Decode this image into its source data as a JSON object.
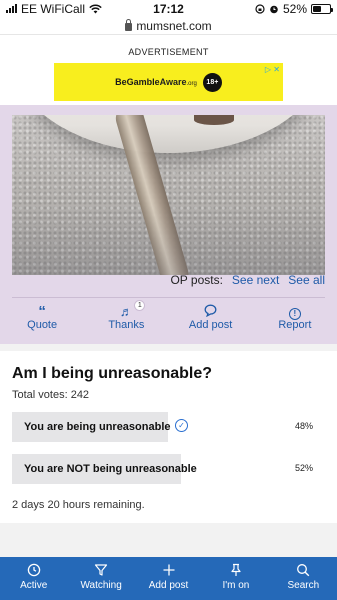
{
  "status_bar": {
    "carrier": "EE WiFiCall",
    "time": "17:12",
    "battery": "52%",
    "battery_level": 0.52,
    "icons": [
      "signal-icon",
      "wifi-icon",
      "lock-rotation-icon",
      "alarm-icon",
      "battery-icon"
    ]
  },
  "browser": {
    "url": "mumsnet.com"
  },
  "ad": {
    "label": "ADVERTISEMENT",
    "brand_prefix": "BeGamble",
    "brand_bold": "Aware",
    "brand_suffix": ".org",
    "age_badge": "18+",
    "adchoices": "▷ ✕"
  },
  "post": {
    "op_label": "OP posts:",
    "see_next": "See next",
    "see_all": "See all",
    "actions": [
      {
        "label": "Quote",
        "icon": "quote-icon"
      },
      {
        "label": "Thanks",
        "icon": "thanks-icon",
        "badge": "1"
      },
      {
        "label": "Add post",
        "icon": "speech-bubble-icon"
      },
      {
        "label": "Report",
        "icon": "alert-icon"
      }
    ]
  },
  "poll": {
    "title": "Am I being unreasonable?",
    "total_votes": "Total votes: 242",
    "options": [
      {
        "label": "You are being unreasonable",
        "percent": "48%",
        "value": 48,
        "selected": true
      },
      {
        "label": "You are NOT being unreasonable",
        "percent": "52%",
        "value": 52,
        "selected": false
      }
    ],
    "remaining": "2 days 20 hours remaining."
  },
  "bottom_nav": [
    {
      "label": "Active",
      "icon": "clock-icon"
    },
    {
      "label": "Watching",
      "icon": "filter-icon"
    },
    {
      "label": "Add post",
      "icon": "plus-icon"
    },
    {
      "label": "I'm on",
      "icon": "pin-icon"
    },
    {
      "label": "Search",
      "icon": "search-icon"
    }
  ],
  "colors": {
    "post_bg": "#e3d7e9",
    "link": "#1f5ba8",
    "nav_bg": "#2569b8",
    "ad_yellow": "#f8ee1e"
  }
}
